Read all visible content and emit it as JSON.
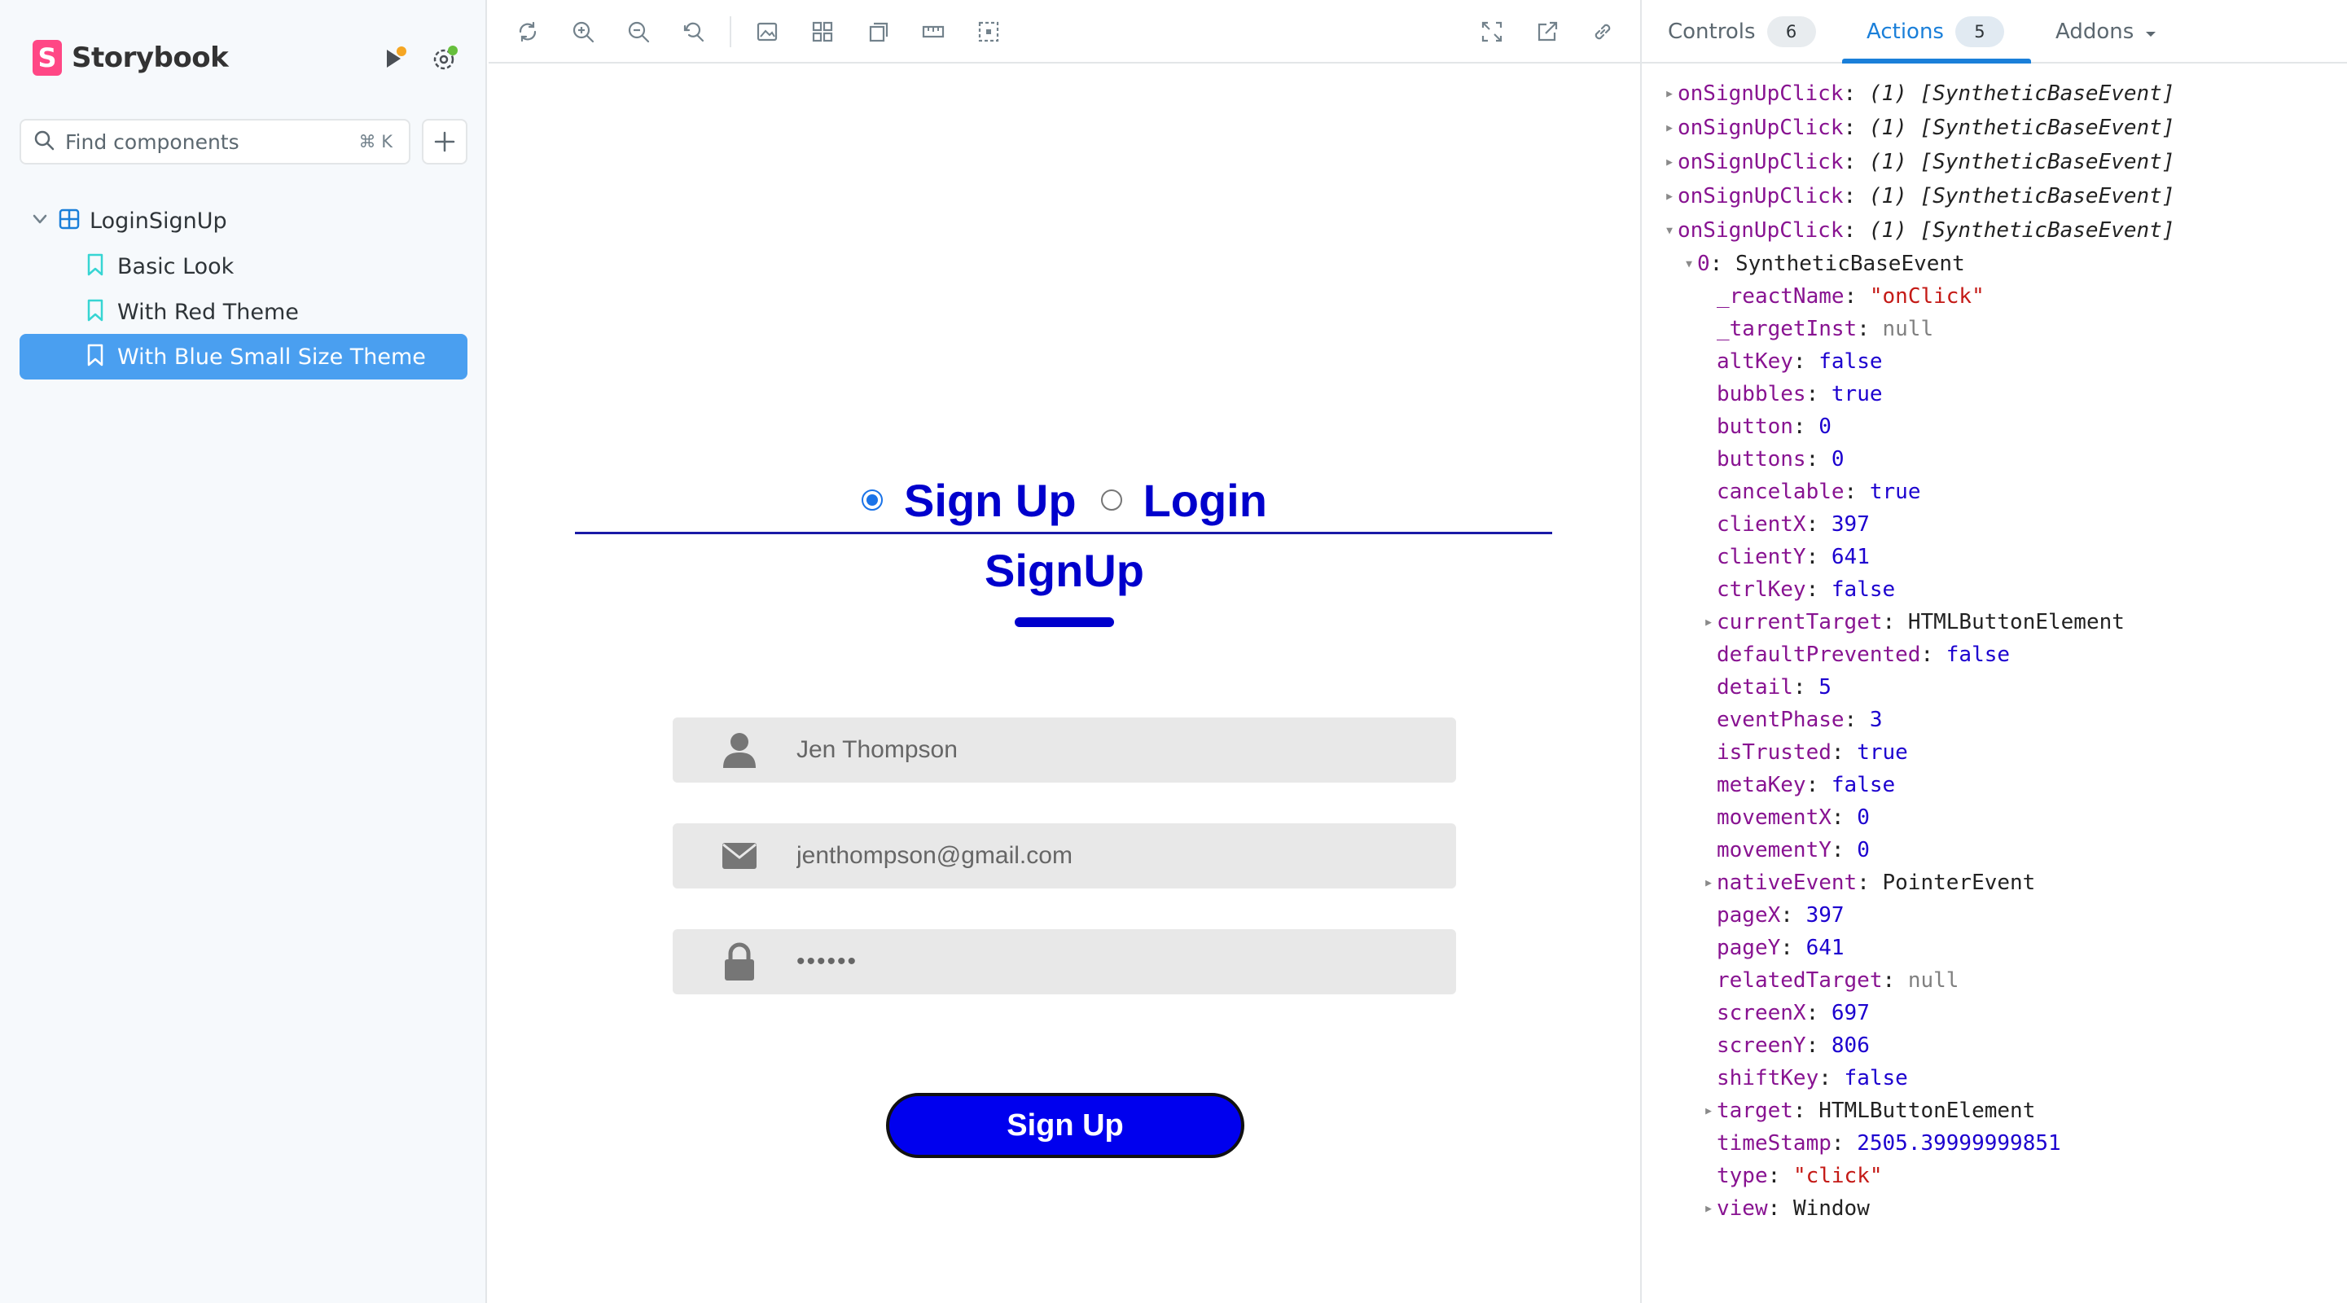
{
  "sidebar": {
    "brand": "Storybook",
    "search": {
      "placeholder": "Find components",
      "shortcut": "⌘ K"
    },
    "group": {
      "label": "LoginSignUp"
    },
    "stories": [
      {
        "label": "Basic Look",
        "active": false
      },
      {
        "label": "With Red Theme",
        "active": false
      },
      {
        "label": "With Blue Small Size Theme",
        "active": true
      }
    ]
  },
  "preview": {
    "modes": [
      {
        "label": "Sign Up",
        "checked": true
      },
      {
        "label": "Login",
        "checked": false
      }
    ],
    "form_title": "SignUp",
    "fields": [
      {
        "icon": "user-icon",
        "value": "Jen Thompson"
      },
      {
        "icon": "envelope-icon",
        "value": "jenthompson@gmail.com"
      },
      {
        "icon": "lock-icon",
        "value": "••••••"
      }
    ],
    "submit_label": "Sign Up"
  },
  "panel": {
    "tabs": [
      {
        "label": "Controls",
        "badge": "6"
      },
      {
        "label": "Actions",
        "badge": "5"
      },
      {
        "label": "Addons"
      }
    ],
    "logs": [
      {
        "name": "onSignUpClick",
        "summary": "(1) [SyntheticBaseEvent]"
      },
      {
        "name": "onSignUpClick",
        "summary": "(1) [SyntheticBaseEvent]"
      },
      {
        "name": "onSignUpClick",
        "summary": "(1) [SyntheticBaseEvent]"
      },
      {
        "name": "onSignUpClick",
        "summary": "(1) [SyntheticBaseEvent]"
      },
      {
        "name": "onSignUpClick",
        "summary": "(1) [SyntheticBaseEvent]"
      }
    ],
    "event_header": {
      "key": "0",
      "value": "SyntheticBaseEvent"
    },
    "props": [
      {
        "key": "_reactName",
        "value": "\"onClick\"",
        "kind": "str"
      },
      {
        "key": "_targetInst",
        "value": "null",
        "kind": "nul"
      },
      {
        "key": "altKey",
        "value": "false",
        "kind": "bool"
      },
      {
        "key": "bubbles",
        "value": "true",
        "kind": "bool"
      },
      {
        "key": "button",
        "value": "0",
        "kind": "num"
      },
      {
        "key": "buttons",
        "value": "0",
        "kind": "num"
      },
      {
        "key": "cancelable",
        "value": "true",
        "kind": "bool"
      },
      {
        "key": "clientX",
        "value": "397",
        "kind": "num"
      },
      {
        "key": "clientY",
        "value": "641",
        "kind": "num"
      },
      {
        "key": "ctrlKey",
        "value": "false",
        "kind": "bool"
      },
      {
        "key": "currentTarget",
        "value": "HTMLButtonElement",
        "kind": "obj"
      },
      {
        "key": "defaultPrevented",
        "value": "false",
        "kind": "bool"
      },
      {
        "key": "detail",
        "value": "5",
        "kind": "num"
      },
      {
        "key": "eventPhase",
        "value": "3",
        "kind": "num"
      },
      {
        "key": "isTrusted",
        "value": "true",
        "kind": "bool"
      },
      {
        "key": "metaKey",
        "value": "false",
        "kind": "bool"
      },
      {
        "key": "movementX",
        "value": "0",
        "kind": "num"
      },
      {
        "key": "movementY",
        "value": "0",
        "kind": "num"
      },
      {
        "key": "nativeEvent",
        "value": "PointerEvent",
        "kind": "obj"
      },
      {
        "key": "pageX",
        "value": "397",
        "kind": "num"
      },
      {
        "key": "pageY",
        "value": "641",
        "kind": "num"
      },
      {
        "key": "relatedTarget",
        "value": "null",
        "kind": "nul"
      },
      {
        "key": "screenX",
        "value": "697",
        "kind": "num"
      },
      {
        "key": "screenY",
        "value": "806",
        "kind": "num"
      },
      {
        "key": "shiftKey",
        "value": "false",
        "kind": "bool"
      },
      {
        "key": "target",
        "value": "HTMLButtonElement",
        "kind": "obj"
      },
      {
        "key": "timeStamp",
        "value": "2505.39999999851",
        "kind": "num"
      },
      {
        "key": "type",
        "value": "\"click\"",
        "kind": "str"
      },
      {
        "key": "view",
        "value": "Window",
        "kind": "obj"
      }
    ]
  },
  "colors": {
    "brand": "#ff4785",
    "active_story": "#4a9ff0",
    "form_blue": "#0000cc",
    "tab_active": "#1a7fd9"
  }
}
